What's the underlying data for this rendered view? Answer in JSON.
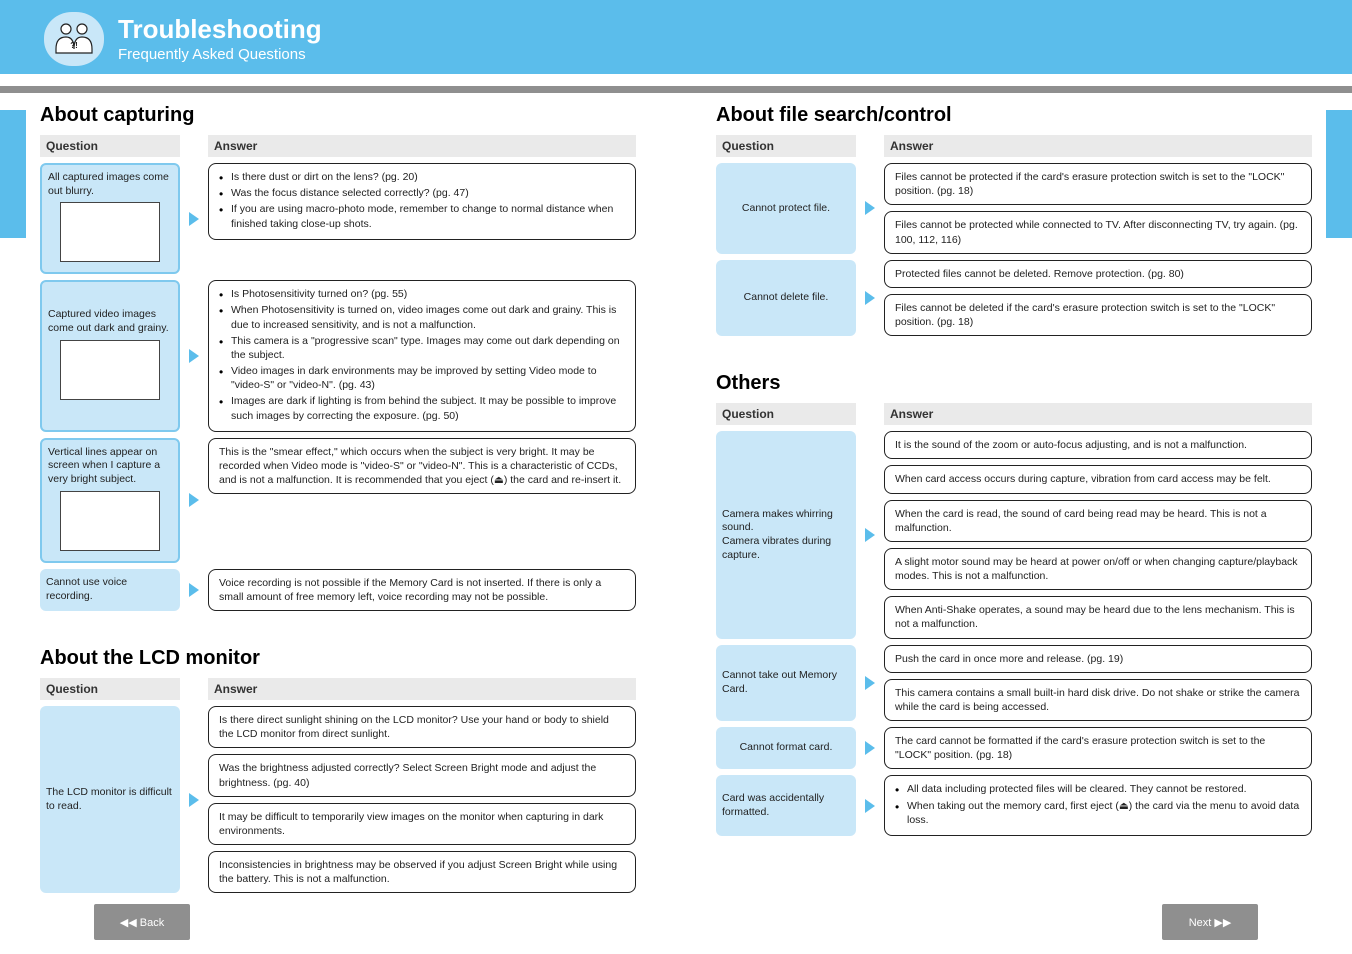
{
  "header": {
    "title": "Troubleshooting",
    "subtitle": "Frequently Asked Questions",
    "icon": "reading-icon"
  },
  "labels": {
    "question_header": "Question",
    "answer_header": "Answer"
  },
  "footer": {
    "back": "◀◀ Back",
    "next": "Next ▶▶"
  },
  "sections": [
    {
      "title": "About capturing",
      "rows": [
        {
          "question": {
            "lines_before": [
              "All captured images come out blurry."
            ],
            "thumb": true,
            "lines_after": []
          },
          "answers": [
            {
              "type": "list",
              "items": [
                "Is there dust or dirt on the lens? (pg. 20)",
                "Was the focus distance selected correctly? (pg. 47)",
                "If you are using macro-photo mode, remember to change to normal distance when finished taking close-up shots."
              ]
            }
          ]
        },
        {
          "question": {
            "lines_before": [
              "Captured video images come out dark and grainy."
            ],
            "thumb": true,
            "lines_after": []
          },
          "answers": [
            {
              "type": "list",
              "items": [
                "Is Photosensitivity turned on? (pg. 55)",
                "When Photosensitivity is turned on, video images come out dark and grainy. This is due to increased sensitivity, and is not a malfunction.",
                "This camera is a \"progressive scan\" type. Images may come out dark depending on the subject.",
                "Video images in dark environments may be improved by setting Video mode to \"video-S\" or \"video-N\". (pg. 43)",
                "Images are dark if lighting is from behind the subject. It may be possible to improve such images by correcting the exposure. (pg. 50)"
              ]
            }
          ]
        },
        {
          "question": {
            "lines_before": [
              "Vertical lines appear on screen when I capture a very bright subject."
            ],
            "thumb": true,
            "lines_after": []
          },
          "answers": [
            {
              "type": "text",
              "text": "This is the \"smear effect,\" which occurs when the subject is very bright. It may be recorded when Video mode is \"video-S\" or \"video-N\". This is a characteristic of CCDs, and is not a malfunction. It is recommended that you eject (⏏) the card and re-insert it."
            }
          ]
        },
        {
          "question": {
            "lines_before": [
              "Cannot use voice recording."
            ],
            "thumb": false,
            "lines_after": []
          },
          "answers": [
            {
              "type": "text",
              "text": "Voice recording is not possible if the Memory Card is not inserted. If there is only a small amount of free memory left, voice recording may not be possible."
            }
          ]
        }
      ]
    },
    {
      "title": "About the LCD monitor",
      "rows": [
        {
          "question": {
            "lines_before": [
              "The LCD monitor is difficult to read."
            ],
            "thumb": false,
            "lines_after": []
          },
          "answers": [
            {
              "type": "text",
              "text": "Is there direct sunlight shining on the LCD monitor? Use your hand or body to shield the LCD monitor from direct sunlight."
            },
            {
              "type": "text",
              "text": "Was the brightness adjusted correctly? Select Screen Bright mode and adjust the brightness. (pg. 40)"
            },
            {
              "type": "text",
              "text": "It may be difficult to temporarily view images on the monitor when capturing in dark environments."
            },
            {
              "type": "text",
              "text": "Inconsistencies in brightness may be observed if you adjust Screen Bright while using the battery. This is not a malfunction."
            }
          ]
        }
      ]
    },
    {
      "title": "About file search/control",
      "rows": [
        {
          "question": {
            "lines_before": [
              "Cannot protect file."
            ],
            "thumb": false,
            "lines_after": []
          },
          "answers": [
            {
              "type": "text",
              "text": "Files cannot be protected if the card's erasure protection switch is set to the \"LOCK\" position. (pg. 18)"
            },
            {
              "type": "text",
              "text": "Files cannot be protected while connected to TV. After disconnecting TV, try again. (pg. 100, 112, 116)"
            }
          ]
        },
        {
          "question": {
            "lines_before": [
              "Cannot delete file."
            ],
            "thumb": false,
            "lines_after": []
          },
          "answers": [
            {
              "type": "text",
              "text": "Protected files cannot be deleted. Remove protection. (pg. 80)"
            },
            {
              "type": "text",
              "text": "Files cannot be deleted if the card's erasure protection switch is set to the \"LOCK\" position. (pg. 18)"
            }
          ]
        }
      ]
    },
    {
      "title": "Others",
      "rows": [
        {
          "question": {
            "lines_before": [
              "Camera makes whirring sound.",
              "Camera vibrates during capture."
            ],
            "thumb": false,
            "lines_after": []
          },
          "answers": [
            {
              "type": "text",
              "text": "It is the sound of the zoom or auto-focus adjusting, and is not a malfunction."
            },
            {
              "type": "text",
              "text": "When card access occurs during capture, vibration from card access may be felt."
            },
            {
              "type": "text",
              "text": "When the card is read, the sound of card being read may be heard. This is not a malfunction."
            },
            {
              "type": "text",
              "text": "A slight motor sound may be heard at power on/off or when changing capture/playback modes. This is not a malfunction."
            },
            {
              "type": "text",
              "text": "When Anti-Shake operates, a sound may be heard due to the lens mechanism. This is not a malfunction."
            }
          ]
        },
        {
          "question": {
            "lines_before": [
              "Cannot take out Memory Card."
            ],
            "thumb": false,
            "lines_after": []
          },
          "answers": [
            {
              "type": "text",
              "text": "Push the card in once more and release. (pg. 19)"
            },
            {
              "type": "text",
              "text": "This camera contains a small built-in hard disk drive. Do not shake or strike the camera while the card is being accessed."
            }
          ]
        },
        {
          "question": {
            "lines_before": [
              "Cannot format card."
            ],
            "thumb": false,
            "lines_after": []
          },
          "answers": [
            {
              "type": "text",
              "text": "The card cannot be formatted if the card's erasure protection switch is set to the \"LOCK\" position. (pg. 18)"
            }
          ]
        },
        {
          "question": {
            "lines_before": [
              "Card was accidentally formatted."
            ],
            "thumb": false,
            "lines_after": []
          },
          "answers": [
            {
              "type": "list",
              "items": [
                "All data including protected files will be cleared. They cannot be restored.",
                "When taking out the memory card, first eject (⏏) the card via the menu to avoid data loss."
              ]
            }
          ]
        }
      ]
    }
  ]
}
